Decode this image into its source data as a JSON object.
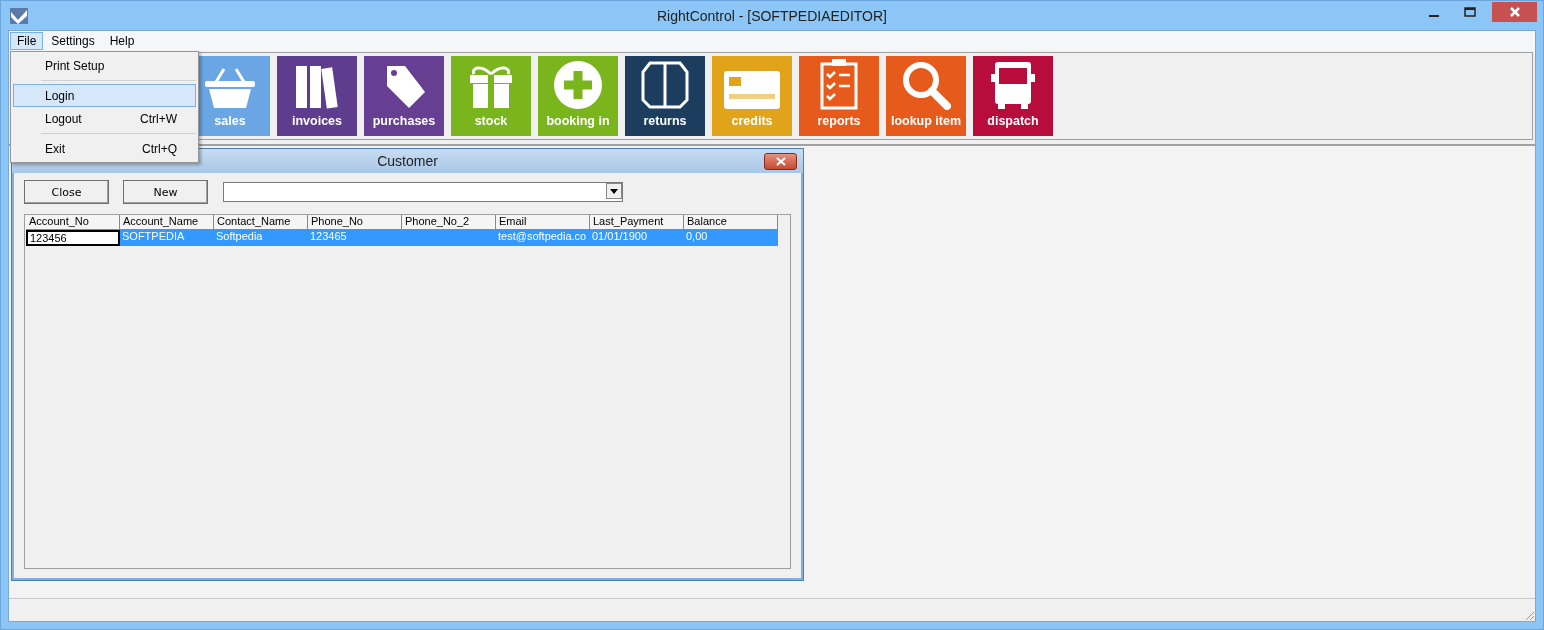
{
  "window": {
    "title": "RightControl - [SOFTPEDIAEDITOR]"
  },
  "menu_bar": [
    {
      "label": "File",
      "selected": true
    },
    {
      "label": "Settings",
      "selected": false
    },
    {
      "label": "Help",
      "selected": false
    }
  ],
  "file_menu": [
    {
      "kind": "item",
      "label": "Print Setup",
      "selected": false
    },
    {
      "kind": "separator"
    },
    {
      "kind": "item",
      "label": "Login",
      "selected": true
    },
    {
      "kind": "item",
      "label": "Logout",
      "shortcut": "Ctrl+W",
      "selected": false
    },
    {
      "kind": "separator"
    },
    {
      "kind": "item",
      "label": "Exit",
      "shortcut": "Ctrl+Q",
      "selected": false
    }
  ],
  "toolbar": [
    {
      "label": "sales",
      "color": "#6aa6e3"
    },
    {
      "label": "invoices",
      "color": "#5f3d8e"
    },
    {
      "label": "purchases",
      "color": "#673f92"
    },
    {
      "label": "stock",
      "color": "#7ab51d"
    },
    {
      "label": "booking in",
      "color": "#7ab51d"
    },
    {
      "label": "returns",
      "color": "#1c3d5e"
    },
    {
      "label": "credits",
      "color": "#e0a31a"
    },
    {
      "label": "reports",
      "color": "#e65a1c"
    },
    {
      "label": "lookup item",
      "color": "#e65a1c"
    },
    {
      "label": "dispatch",
      "color": "#b80c3c"
    }
  ],
  "customer_window": {
    "title": "Customer",
    "buttons": [
      "Close",
      "New"
    ],
    "columns": [
      "Account_No",
      "Account_Name",
      "Contact_Name",
      "Phone_No",
      "Phone_No_2",
      "Email",
      "Last_Payment",
      "Balance"
    ],
    "rows": [
      {
        "selected": true,
        "cells": [
          {
            "text": "123456",
            "focused": true
          },
          {
            "text": "SOFTPEDIA",
            "focused": false
          },
          {
            "text": "Softpedia",
            "focused": false
          },
          {
            "text": "123465",
            "focused": false
          },
          {
            "text": "",
            "focused": false
          },
          {
            "text": "test@softpedia.co",
            "focused": false
          },
          {
            "text": "01/01/1900",
            "focused": false
          },
          {
            "text": "0,00",
            "focused": false
          }
        ]
      }
    ]
  }
}
